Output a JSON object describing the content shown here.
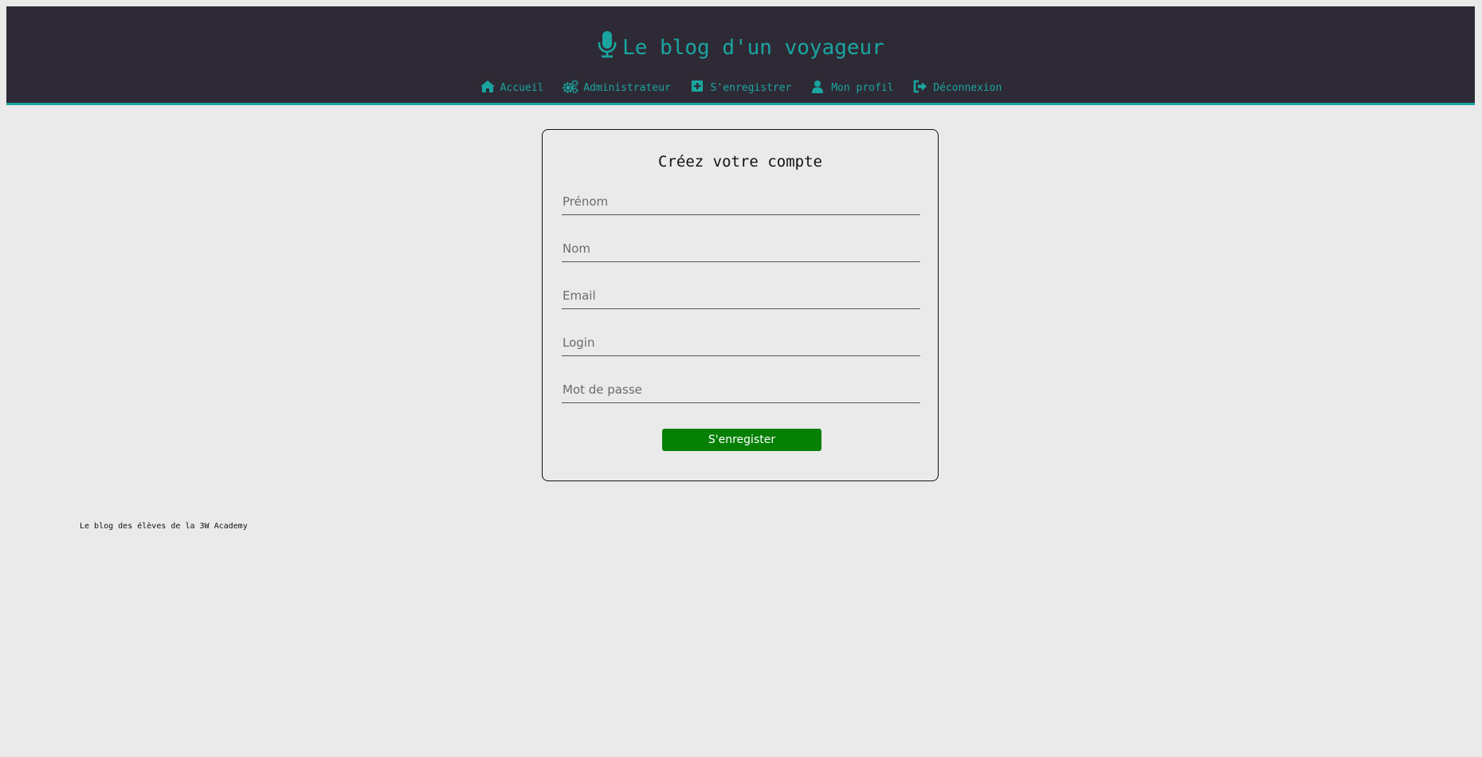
{
  "header": {
    "title": "Le blog d'un voyageur",
    "title_icon": "microphone-icon",
    "accent_color": "#1aa5a0",
    "background_color": "#2e2a35"
  },
  "nav": {
    "items": [
      {
        "label": "Accueil",
        "icon": "home-icon"
      },
      {
        "label": "Administrateur",
        "icon": "cogs-icon"
      },
      {
        "label": "S'enregistrer",
        "icon": "plus-square-icon"
      },
      {
        "label": "Mon profil",
        "icon": "user-icon"
      },
      {
        "label": "Déconnexion",
        "icon": "sign-out-icon"
      }
    ]
  },
  "form": {
    "title": "Créez votre compte",
    "fields": [
      {
        "placeholder": "Prénom",
        "value": ""
      },
      {
        "placeholder": "Nom",
        "value": ""
      },
      {
        "placeholder": "Email",
        "value": ""
      },
      {
        "placeholder": "Login",
        "value": ""
      },
      {
        "placeholder": "Mot de passe",
        "value": ""
      }
    ],
    "submit_label": "S'enregister",
    "submit_color": "#058005"
  },
  "footer": {
    "text": "Le blog des élèves de la 3W Academy"
  }
}
